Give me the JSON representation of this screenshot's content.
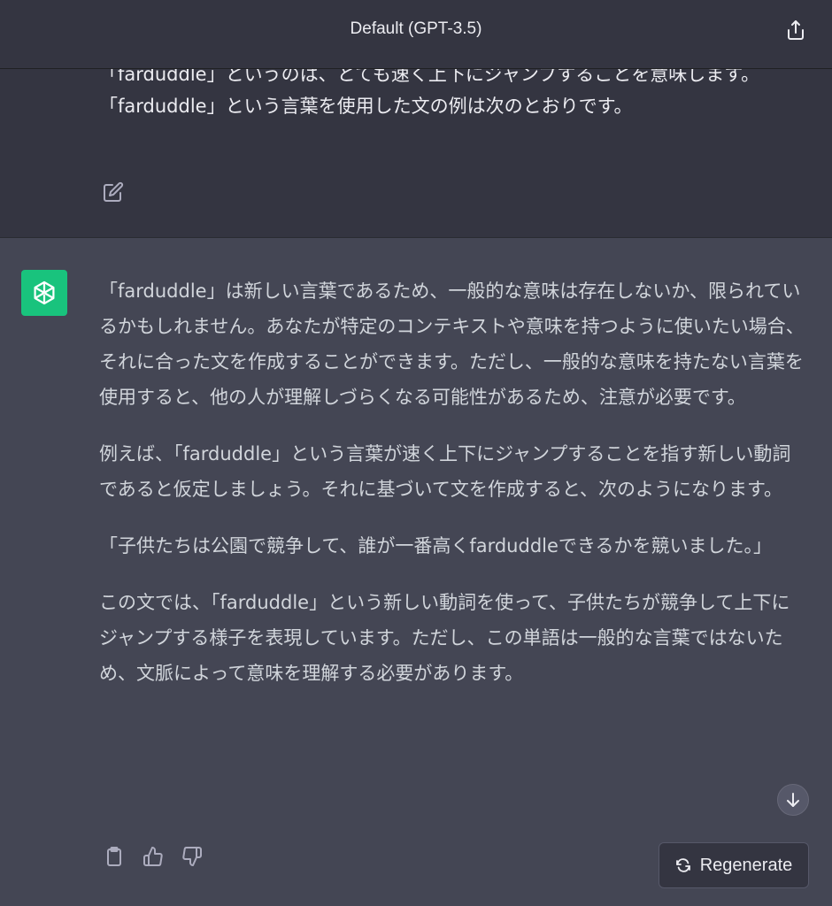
{
  "header": {
    "title": "Default (GPT-3.5)",
    "share_icon": "share-icon"
  },
  "user_message": {
    "lines": [
      "「farduddle」というのは、とても速く上下にジャンプすることを意味します。",
      "「farduddle」という言葉を使用した文の例は次のとおりです。"
    ],
    "edit_icon": "edit-icon"
  },
  "assistant_message": {
    "avatar_icon": "openai-logo-icon",
    "paragraphs": [
      "「farduddle」は新しい言葉であるため、一般的な意味は存在しないか、限られているかもしれません。あなたが特定のコンテキストや意味を持つように使いたい場合、それに合った文を作成することができます。ただし、一般的な意味を持たない言葉を使用すると、他の人が理解しづらくなる可能性があるため、注意が必要です。",
      "例えば、「farduddle」という言葉が速く上下にジャンプすることを指す新しい動詞であると仮定しましょう。それに基づいて文を作成すると、次のようになります。",
      "「子供たちは公園で競争して、誰が一番高くfarduddleできるかを競いました。」",
      "この文では、「farduddle」という新しい動詞を使って、子供たちが競争して上下にジャンプする様子を表現しています。ただし、この単語は一般的な言葉ではないため、文脈によって意味を理解する必要があります。"
    ],
    "actions": [
      "copy-icon",
      "thumbs-up-icon",
      "thumbs-down-icon"
    ]
  },
  "controls": {
    "regenerate_label": "Regenerate",
    "scroll_icon": "arrow-down-icon"
  },
  "colors": {
    "background": "#444654",
    "user_bg": "#343541",
    "accent": "#19c37d"
  }
}
